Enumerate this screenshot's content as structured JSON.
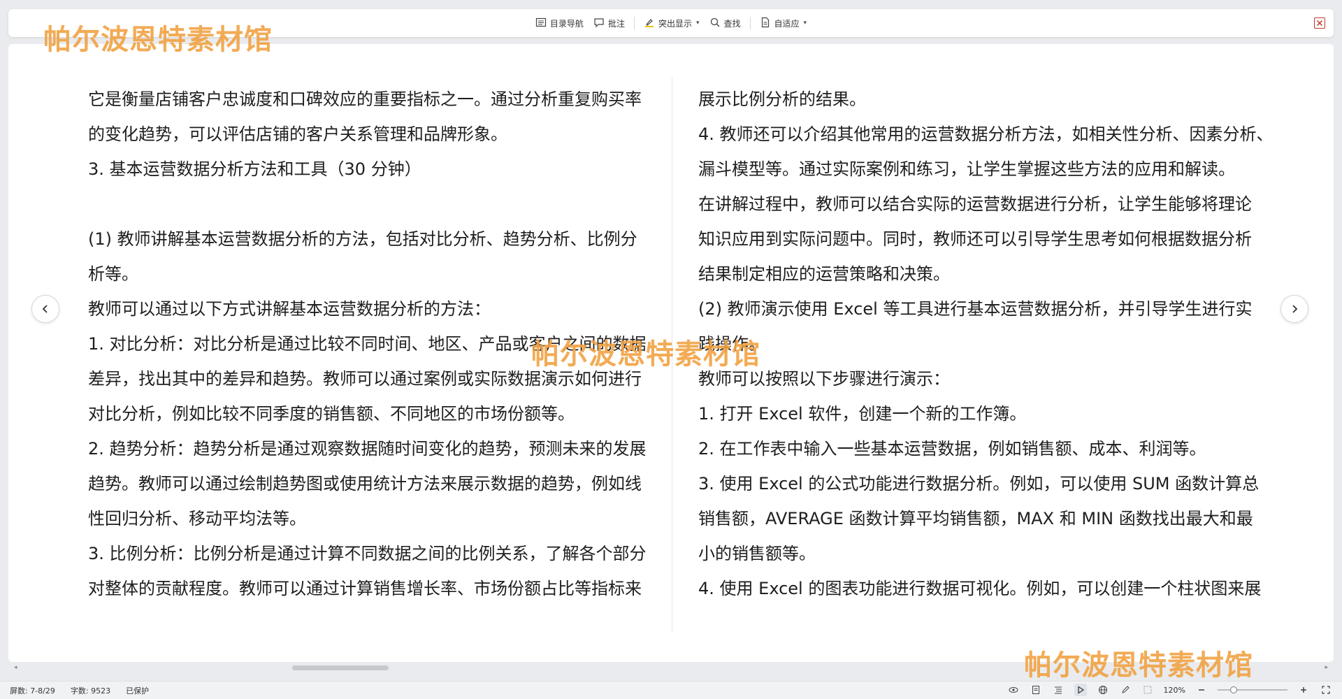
{
  "toolbar": {
    "nav_label": "目录导航",
    "comment_label": "批注",
    "highlight_label": "突出显示",
    "find_label": "查找",
    "fit_label": "自适应"
  },
  "document": {
    "left_lines": [
      "它是衡量店铺客户忠诚度和口碑效应的重要指标之一。通过分析重复购买率",
      "的变化趋势，可以评估店铺的客户关系管理和品牌形象。",
      "3.  基本运营数据分析方法和工具（30 分钟）",
      "",
      "(1)  教师讲解基本运营数据分析的方法，包括对比分析、趋势分析、比例分",
      "析等。",
      "教师可以通过以下方式讲解基本运营数据分析的方法：",
      "1.  对比分析：对比分析是通过比较不同时间、地区、产品或客户之间的数据",
      "差异，找出其中的差异和趋势。教师可以通过案例或实际数据演示如何进行",
      "对比分析，例如比较不同季度的销售额、不同地区的市场份额等。",
      "2.  趋势分析：趋势分析是通过观察数据随时间变化的趋势，预测未来的发展",
      "趋势。教师可以通过绘制趋势图或使用统计方法来展示数据的趋势，例如线",
      "性回归分析、移动平均法等。",
      "3.  比例分析：比例分析是通过计算不同数据之间的比例关系，了解各个部分",
      "对整体的贡献程度。教师可以通过计算销售增长率、市场份额占比等指标来"
    ],
    "right_lines": [
      "展示比例分析的结果。",
      "4.  教师还可以介绍其他常用的运营数据分析方法，如相关性分析、因素分析、",
      "漏斗模型等。通过实际案例和练习，让学生掌握这些方法的应用和解读。",
      "在讲解过程中，教师可以结合实际的运营数据进行分析，让学生能够将理论",
      "知识应用到实际问题中。同时，教师还可以引导学生思考如何根据数据分析",
      "结果制定相应的运营策略和决策。",
      "(2)  教师演示使用 Excel 等工具进行基本运营数据分析，并引导学生进行实",
      "践操作。",
      "教师可以按照以下步骤进行演示：",
      "1.  打开 Excel 软件，创建一个新的工作簿。",
      "2.  在工作表中输入一些基本运营数据，例如销售额、成本、利润等。",
      "3.  使用 Excel 的公式功能进行数据分析。例如，可以使用 SUM 函数计算总",
      "销售额，AVERAGE 函数计算平均销售额，MAX 和 MIN 函数找出最大和最",
      "小的销售额等。",
      "4.  使用 Excel 的图表功能进行数据可视化。例如，可以创建一个柱状图来展"
    ]
  },
  "status": {
    "pages": "屏数: 7-8/29",
    "word_count": "字数: 9523",
    "protection": "已保护",
    "zoom": "120%",
    "zoom_fraction": 0.2
  },
  "watermark": {
    "text": "帕尔波恩特素材馆"
  },
  "colors": {
    "watermark": "#f1a243",
    "close": "#c0392b",
    "accent": "#4a7bd0"
  },
  "icons": {
    "nav": "catalog-icon",
    "comment": "comment-icon",
    "highlight": "highlight-pen-icon",
    "find": "search-icon",
    "fit": "page-fit-icon",
    "close": "close-icon",
    "prev": "chevron-left-icon",
    "next": "chevron-right-icon"
  }
}
